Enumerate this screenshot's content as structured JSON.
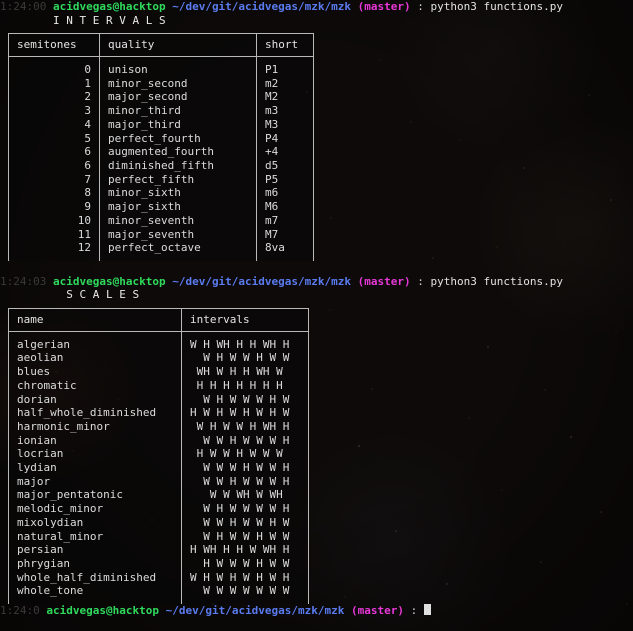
{
  "terminal": {
    "background_color": "#0d0a09",
    "foreground_color": "#d8d8d8",
    "colors": {
      "timestamp": "#3a3a3a",
      "user_host": "#2fd95c",
      "path": "#5a7bf0",
      "branch": "#e838d8",
      "command": "#e2e2e2",
      "border": "#b9b9b9"
    }
  },
  "prompt1": {
    "timestamp": "1:24:00",
    "user_host": "acidvegas@hacktop",
    "path": "~/dev/git/acidvegas/mzk/mzk",
    "branch": "(master)",
    "separator": ":",
    "command": "python3 functions.py"
  },
  "banner1": "        I N T E R V A L S",
  "intervals_table": {
    "headers": [
      "semitones",
      "quality",
      "short"
    ],
    "rows": [
      {
        "semitones": "0",
        "quality": "unison",
        "short": "P1"
      },
      {
        "semitones": "1",
        "quality": "minor_second",
        "short": "m2"
      },
      {
        "semitones": "2",
        "quality": "major_second",
        "short": "M2"
      },
      {
        "semitones": "3",
        "quality": "minor_third",
        "short": "m3"
      },
      {
        "semitones": "4",
        "quality": "major_third",
        "short": "M3"
      },
      {
        "semitones": "5",
        "quality": "perfect_fourth",
        "short": "P4"
      },
      {
        "semitones": "6",
        "quality": "augmented_fourth",
        "short": "+4"
      },
      {
        "semitones": "6",
        "quality": "diminished_fifth",
        "short": "d5"
      },
      {
        "semitones": "7",
        "quality": "perfect_fifth",
        "short": "P5"
      },
      {
        "semitones": "8",
        "quality": "minor_sixth",
        "short": "m6"
      },
      {
        "semitones": "9",
        "quality": "major_sixth",
        "short": "M6"
      },
      {
        "semitones": "10",
        "quality": "minor_seventh",
        "short": "m7"
      },
      {
        "semitones": "11",
        "quality": "major_seventh",
        "short": "M7"
      },
      {
        "semitones": "12",
        "quality": "perfect_octave",
        "short": "8va"
      }
    ]
  },
  "prompt2": {
    "timestamp": "1:24:03",
    "user_host": "acidvegas@hacktop",
    "path": "~/dev/git/acidvegas/mzk/mzk",
    "branch": "(master)",
    "separator": ":",
    "command": "python3 functions.py"
  },
  "banner2": "          S C A L E S",
  "scales_table": {
    "headers": [
      "name",
      "intervals"
    ],
    "rows": [
      {
        "name": "algerian",
        "intervals": "W H WH H H WH H"
      },
      {
        "name": "aeolian",
        "intervals": "  W H W W H W W"
      },
      {
        "name": "blues",
        "intervals": " WH W H H WH W"
      },
      {
        "name": "chromatic",
        "intervals": " H H H H H H H"
      },
      {
        "name": "dorian",
        "intervals": "  W H W W W H W"
      },
      {
        "name": "half_whole_diminished",
        "intervals": "H W H W H W H W"
      },
      {
        "name": "harmonic_minor",
        "intervals": " W H W W H WH H"
      },
      {
        "name": "ionian",
        "intervals": "  W W H W W W H"
      },
      {
        "name": "locrian",
        "intervals": " H W W H W W W"
      },
      {
        "name": "lydian",
        "intervals": "  W W W H W W H"
      },
      {
        "name": "major",
        "intervals": "  W W H W W W H"
      },
      {
        "name": "major_pentatonic",
        "intervals": "   W W WH W WH"
      },
      {
        "name": "melodic_minor",
        "intervals": "  W H W W W W H"
      },
      {
        "name": "mixolydian",
        "intervals": "  W W H W W H W"
      },
      {
        "name": "natural_minor",
        "intervals": "  W H W W H W W"
      },
      {
        "name": "persian",
        "intervals": "H WH H H W WH H"
      },
      {
        "name": "phrygian",
        "intervals": "  H W W W H W W"
      },
      {
        "name": "whole_half_diminished",
        "intervals": "W H W H W H W H"
      },
      {
        "name": "whole_tone",
        "intervals": "  W W W W W W W"
      }
    ]
  },
  "prompt3": {
    "timestamp": "1:24:0",
    "user_host": "acidvegas@hacktop",
    "path": "~/dev/git/acidvegas/mzk/mzk",
    "branch": "(master)",
    "separator": ":",
    "cursor": "block-cursor"
  }
}
